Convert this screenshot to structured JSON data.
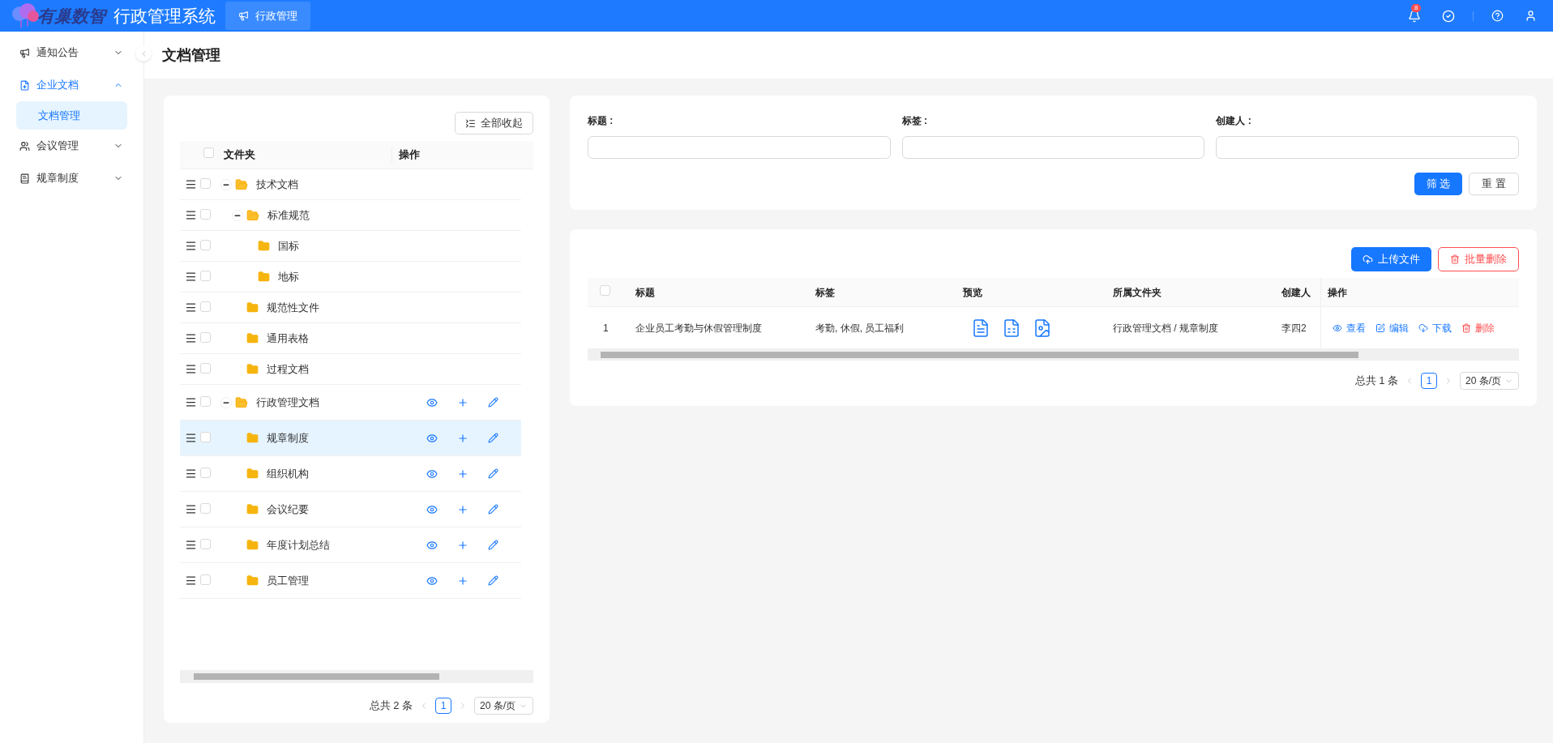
{
  "header": {
    "logo_text": "有巢数智",
    "title": "行政管理系统",
    "tabs": [
      {
        "label": "行政管理",
        "selected": true
      }
    ],
    "notification_count": "8"
  },
  "sidebar": {
    "items": [
      {
        "label": "通知公告",
        "expanded": false,
        "selected": false
      },
      {
        "label": "企业文档",
        "expanded": true,
        "selected": true,
        "children": [
          {
            "label": "文档管理",
            "selected": true
          }
        ]
      },
      {
        "label": "会议管理",
        "expanded": false,
        "selected": false
      },
      {
        "label": "规章制度",
        "expanded": false,
        "selected": false
      }
    ]
  },
  "page_title": "文档管理",
  "folder_panel": {
    "collapse_all_button": "全部收起",
    "columns": [
      "文件夹",
      "操作"
    ],
    "header_checked": false,
    "tree": [
      {
        "name": "技术文档",
        "expanded": true,
        "checked": false,
        "selected": false,
        "actions": false,
        "children": [
          {
            "name": "标准规范",
            "expanded": true,
            "checked": false,
            "selected": false,
            "actions": false,
            "children": [
              {
                "name": "国标",
                "checked": false,
                "selected": false,
                "actions": false
              },
              {
                "name": "地标",
                "checked": false,
                "selected": false,
                "actions": false
              }
            ]
          },
          {
            "name": "规范性文件",
            "checked": false,
            "selected": false,
            "actions": false
          },
          {
            "name": "通用表格",
            "checked": false,
            "selected": false,
            "actions": false
          },
          {
            "name": "过程文档",
            "checked": false,
            "selected": false,
            "actions": false
          }
        ]
      },
      {
        "name": "行政管理文档",
        "expanded": true,
        "checked": false,
        "selected": false,
        "actions": true,
        "children": [
          {
            "name": "规章制度",
            "checked": false,
            "selected": true,
            "actions": true
          },
          {
            "name": "组织机构",
            "checked": false,
            "selected": false,
            "actions": true
          },
          {
            "name": "会议纪要",
            "checked": false,
            "selected": false,
            "actions": true
          },
          {
            "name": "年度计划总结",
            "checked": false,
            "selected": false,
            "actions": true
          },
          {
            "name": "员工管理",
            "checked": false,
            "selected": false,
            "actions": true
          }
        ]
      }
    ],
    "pagination": {
      "total": "总共 2 条",
      "pages": [
        {
          "label": "1",
          "selected": true
        }
      ],
      "page_size": "20 条/页"
    }
  },
  "filter": {
    "fields": [
      {
        "label": "标题 :"
      },
      {
        "label": "标签 :"
      },
      {
        "label": "创建人 :"
      }
    ],
    "buttons": [
      {
        "label": "筛 选",
        "kind": "primary"
      },
      {
        "label": "重 置",
        "kind": "default"
      }
    ]
  },
  "documents": {
    "toolbar": [
      {
        "label": "上传文件",
        "kind": "primary"
      },
      {
        "label": "批量删除",
        "kind": "danger"
      }
    ],
    "columns": [
      "标题",
      "标签",
      "预览",
      "所属文件夹",
      "创建人",
      "操作"
    ],
    "header_checked": false,
    "rows": [
      {
        "index": "1",
        "title": "企业员工考勤与休假管理制度",
        "tags": "考勤, 休假, 员工福利",
        "previews": [
          {
            "kind": "word"
          },
          {
            "kind": "excel"
          },
          {
            "kind": "image"
          }
        ],
        "folder": "行政管理文档 / 规章制度",
        "creator": "李四2",
        "actions": [
          {
            "label": "查看",
            "kind": "view"
          },
          {
            "label": "编辑",
            "kind": "edit"
          },
          {
            "label": "下载",
            "kind": "download"
          },
          {
            "label": "删除",
            "kind": "delete"
          }
        ]
      }
    ],
    "pagination": {
      "total": "总共 1 条",
      "pages": [
        {
          "label": "1",
          "selected": true
        }
      ],
      "page_size": "20 条/页"
    }
  }
}
